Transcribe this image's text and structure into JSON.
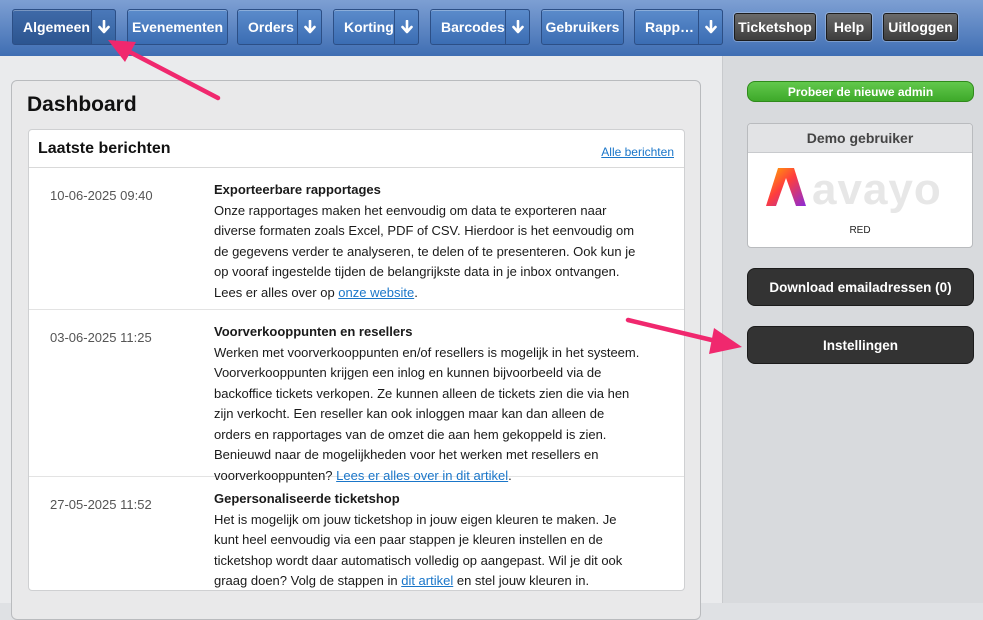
{
  "nav": {
    "items": [
      {
        "label": "Algemeen",
        "has_menu": true
      },
      {
        "label": "Evenementen",
        "has_menu": false
      },
      {
        "label": "Orders",
        "has_menu": true
      },
      {
        "label": "Korting",
        "has_menu": true
      },
      {
        "label": "Barcodes",
        "has_menu": true
      },
      {
        "label": "Gebruikers",
        "has_menu": false
      },
      {
        "label": "Rapp…",
        "has_menu": true
      }
    ],
    "right_buttons": [
      {
        "label": "Ticketshop"
      },
      {
        "label": "Help"
      },
      {
        "label": "Uitloggen"
      }
    ],
    "menu_icon": "arrow-down-icon"
  },
  "dashboard": {
    "title": "Dashboard",
    "messages_title": "Laatste berichten",
    "all_link": "Alle berichten",
    "messages": [
      {
        "date": "10-06-2025 09:40",
        "title": "Exporteerbare rapportages",
        "text": "Onze rapportages maken het eenvoudig om data te exporteren naar diverse formaten zoals Excel, PDF of CSV. Hierdoor is het eenvoudig om de gegevens verder te analyseren, te delen of te presenteren. Ook kun je op vooraf ingestelde tijden de belangrijkste data in je inbox ontvangen. Lees er alles over op ",
        "link": "onze website",
        "after": "."
      },
      {
        "date": "03-06-2025 11:25",
        "title": "Voorverkooppunten en resellers",
        "text": "Werken met voorverkooppunten en/of resellers is mogelijk in het systeem. Voorverkooppunten krijgen een inlog en kunnen bijvoorbeeld via de backoffice tickets verkopen. Ze kunnen alleen de tickets zien die via hen zijn verkocht.  Een reseller kan ook inloggen maar kan dan alleen de orders en rapportages van de omzet die aan hem gekoppeld is zien. Benieuwd naar de mogelijkheden voor het werken met resellers en voorverkooppunten? ",
        "link": "Lees er alles over in dit artikel",
        "after": "."
      },
      {
        "date": "27-05-2025 11:52",
        "title": "Gepersonaliseerde ticketshop",
        "text": "Het is mogelijk om jouw ticketshop in jouw eigen kleuren te maken. Je kunt heel eenvoudig via een paar stappen je kleuren instellen en de ticketshop wordt daar automatisch volledig op aangepast. Wil je dit ook graag doen? Volg de stappen in ",
        "link": "dit artikel",
        "after": " en stel jouw kleuren in."
      }
    ]
  },
  "sidebar": {
    "try_new_admin": "Probeer de nieuwe admin",
    "demo_title": "Demo gebruiker",
    "logo_text": "avayo",
    "demo_org": "RED",
    "download_button": "Download emailadressen (0)",
    "settings_button": "Instellingen"
  },
  "colors": {
    "nav_blue": "#3f6eb3",
    "link_blue": "#1a76c9",
    "green": "#4cb536",
    "dark_button": "#333333",
    "annotation_arrow": "#f0286e"
  }
}
